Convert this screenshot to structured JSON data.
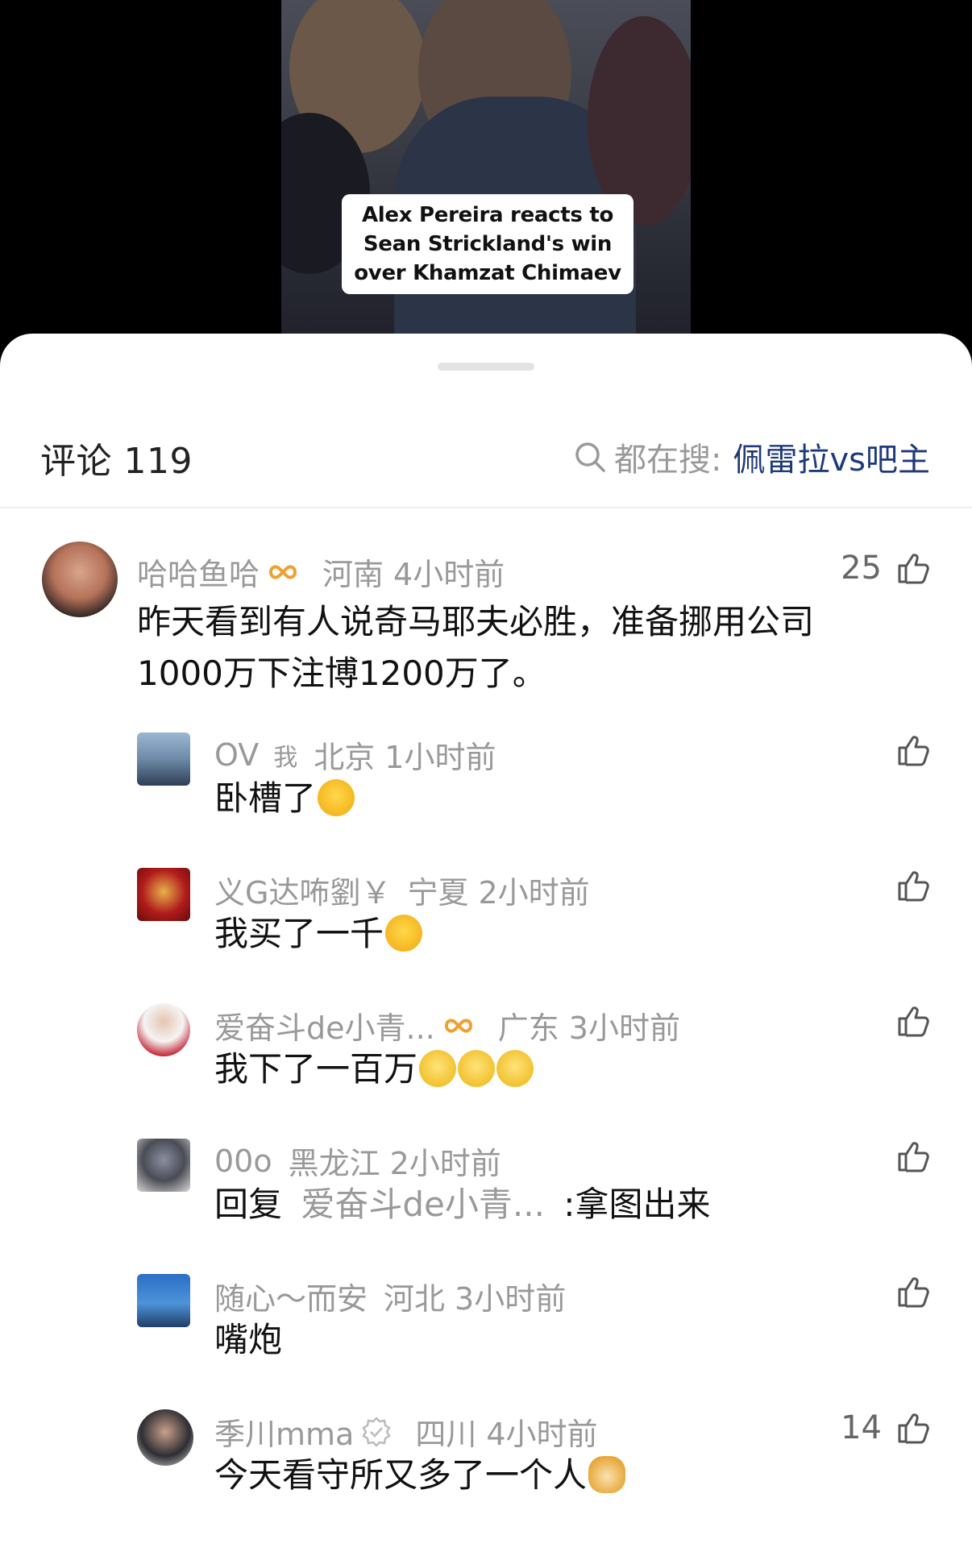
{
  "video": {
    "caption": "Alex Pereira reacts to\nSean Strickland's win\nover Khamzat Chimaev"
  },
  "header": {
    "comments_label": "评论 119",
    "search_prefix": "都在搜:",
    "search_term": "佩雷拉vs吧主"
  },
  "comments": [
    {
      "user": "哈哈鱼哈",
      "location": "河南",
      "time": "4小时前",
      "likes": "25",
      "text": "昨天看到有人说奇马耶夫必胜，准备挪用公司1000万下注博1200万了。"
    },
    {
      "user": "OV",
      "tag": "我",
      "location": "北京",
      "time": "1小时前",
      "likes": "",
      "text": "卧槽了"
    },
    {
      "user": "义G达咘劉￥",
      "location": "宁夏",
      "time": "2小时前",
      "likes": "",
      "text": "我买了一千"
    },
    {
      "user": "爱奋斗de小青...",
      "location": "广东",
      "time": "3小时前",
      "likes": "",
      "text": "我下了一百万"
    },
    {
      "user": "00o",
      "location": "黑龙江",
      "time": "2小时前",
      "likes": "",
      "reply_prefix": "回复",
      "reply_to": "爱奋斗de小青...",
      "text": ":拿图出来"
    },
    {
      "user": "随心～而安",
      "location": "河北",
      "time": "3小时前",
      "likes": "",
      "text": "嘴炮"
    },
    {
      "user": "季川mma",
      "location": "四川",
      "time": "4小时前",
      "likes": "14",
      "text": "今天看守所又多了一个人"
    }
  ],
  "colors": {
    "accent_link": "#1e3a78",
    "meta_gray": "#999999",
    "badge_orange": "#f0a030"
  },
  "icons": [
    "search-icon",
    "thumbs-up-icon",
    "infinity-badge-icon",
    "verified-badge-icon",
    "laugh-cry-emoji",
    "money-eyes-emoji",
    "doge-emoji"
  ]
}
